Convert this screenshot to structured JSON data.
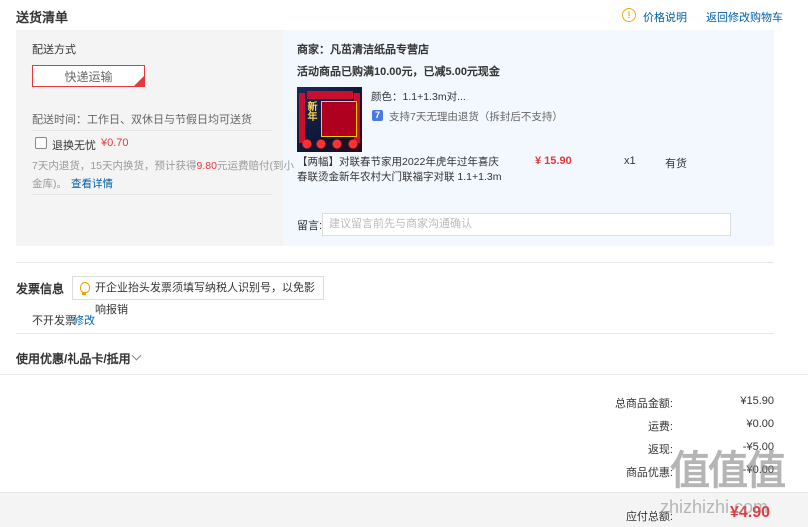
{
  "delivery_list": {
    "title": "送货清单",
    "price_info_link": "价格说明",
    "back_to_cart_link": "返回修改购物车"
  },
  "shipping": {
    "section_label": "配送方式",
    "method_button": "快递运输",
    "delivery_time": "配送时间：工作日、双休日与节假日均可送货",
    "return_worry_free_label": "退换无忧",
    "return_worry_free_price": "¥0.70",
    "return_desc_1": "7天内退货，15天内换货，预计获得",
    "return_desc_amount": "9.80",
    "return_desc_2": "元运费赔付(到小",
    "return_desc_3": "金库)。",
    "view_details_link": "查看详情"
  },
  "shop": {
    "name": "商家：凡茁清洁纸品专营店",
    "promo": "活动商品已购满10.00元，已减5.00元现金",
    "product": {
      "color": "颜色：1.1+1.3m对...",
      "support_icon": "7",
      "support_text": "支持7天无理由退货（拆封后不支持）",
      "title_line1": "【两幅】对联春节家用2022年虎年过年喜庆",
      "title_line2": "春联烫金新年农村大门联福字对联 1.1+1.3m",
      "price": "¥ 15.90",
      "quantity": "x1",
      "stock": "有货",
      "image_text": "新年"
    },
    "memo_label": "留言:",
    "memo_placeholder": "建议留言前先与商家沟通确认"
  },
  "invoice": {
    "title": "发票信息",
    "tip": "开企业抬头发票须填写纳税人识别号，以免影响报销",
    "status": "不开发票",
    "edit_link": "修改"
  },
  "coupons": {
    "title": "使用优惠/礼品卡/抵用"
  },
  "summary": {
    "total_goods_label": "总商品金额:",
    "total_goods_value": "¥15.90",
    "freight_label": "运费:",
    "freight_value": "¥0.00",
    "cashback_label": "返现:",
    "cashback_value": "-¥5.00",
    "discount_label": "商品优惠:",
    "discount_value": "-¥0.00",
    "payable_label": "应付总额:",
    "payable_value": "¥4.90"
  },
  "watermark": {
    "logo_text": "值值值",
    "url_text": "zhizhizhi.com"
  },
  "colors": {
    "accent_red": "#e4393c",
    "link_blue": "#005ea7",
    "shop_panel_bg": "#f3f8fe",
    "box_bg": "#f4f4f4"
  }
}
